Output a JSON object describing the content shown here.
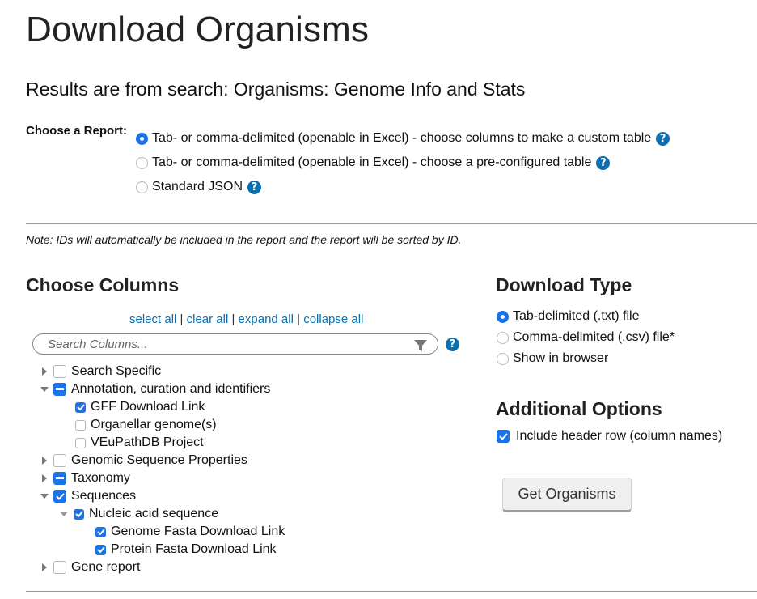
{
  "page": {
    "title": "Download Organisms",
    "subtitle": "Results are from search: Organisms: Genome Info and Stats"
  },
  "report": {
    "label": "Choose a Report:",
    "options": [
      {
        "label": "Tab- or comma-delimited (openable in Excel) - choose columns to make a custom table",
        "selected": true
      },
      {
        "label": "Tab- or comma-delimited (openable in Excel) - choose a pre-configured table",
        "selected": false
      },
      {
        "label": "Standard JSON",
        "selected": false
      }
    ],
    "help_glyph": "?"
  },
  "note": "Note: IDs will automatically be included in the report and the report will be sorted by ID.",
  "columns": {
    "heading": "Choose Columns",
    "links": {
      "select_all": "select all",
      "clear_all": "clear all",
      "expand_all": "expand all",
      "collapse_all": "collapse all",
      "separator": "|"
    },
    "search_placeholder": "Search Columns...",
    "tree": [
      {
        "label": "Search Specific",
        "state": "unchecked",
        "expanded": false
      },
      {
        "label": "Annotation, curation and identifiers",
        "state": "mixed",
        "expanded": true
      },
      {
        "label": "GFF Download Link",
        "state": "checked"
      },
      {
        "label": "Organellar genome(s)",
        "state": "unchecked"
      },
      {
        "label": "VEuPathDB Project",
        "state": "unchecked"
      },
      {
        "label": "Genomic Sequence Properties",
        "state": "unchecked",
        "expanded": false
      },
      {
        "label": "Taxonomy",
        "state": "mixed",
        "expanded": false
      },
      {
        "label": "Sequences",
        "state": "checked",
        "expanded": true
      },
      {
        "label": "Nucleic acid sequence",
        "state": "checked",
        "expanded": true
      },
      {
        "label": "Genome Fasta Download Link",
        "state": "checked"
      },
      {
        "label": "Protein Fasta Download Link",
        "state": "checked"
      },
      {
        "label": "Gene report",
        "state": "unchecked",
        "expanded": false
      }
    ]
  },
  "download_type": {
    "heading": "Download Type",
    "options": [
      {
        "label": "Tab-delimited (.txt) file",
        "selected": true
      },
      {
        "label": "Comma-delimited (.csv) file*",
        "selected": false
      },
      {
        "label": "Show in browser",
        "selected": false
      }
    ]
  },
  "additional_options": {
    "heading": "Additional Options",
    "include_header_label": "Include header row (column names)",
    "include_header_checked": true
  },
  "submit_button": "Get Organisms",
  "colors": {
    "accent": "#1a73e8",
    "link": "#0b6fb0",
    "help": "#0b6fb0"
  }
}
